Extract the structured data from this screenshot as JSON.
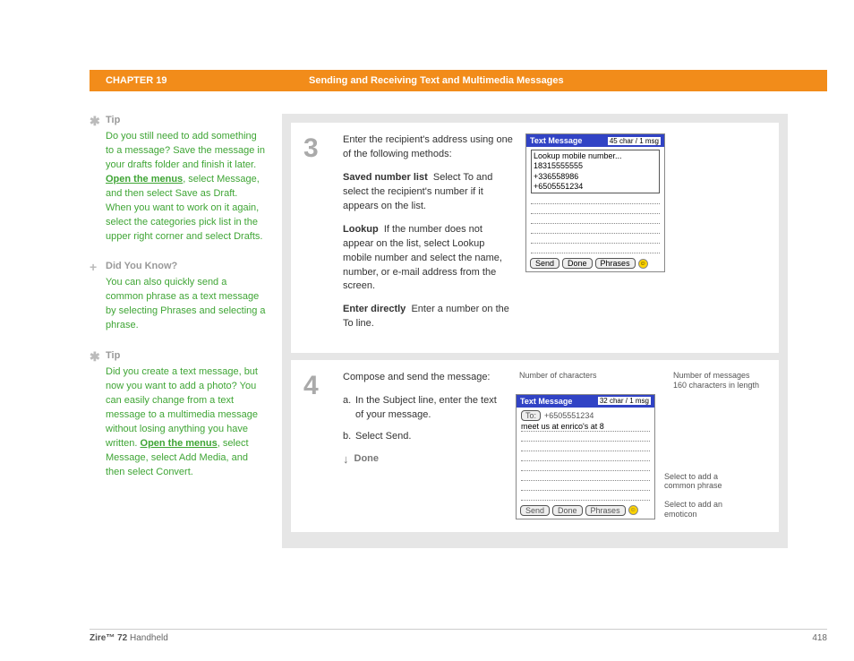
{
  "header": {
    "chapter": "CHAPTER 19",
    "title": "Sending and Receiving Text and Multimedia Messages"
  },
  "sidebar": {
    "tip1": {
      "label": "Tip",
      "body_1": "Do you still need to add something to a message? Save the message in your drafts folder and finish it later. ",
      "link": "Open the menus",
      "body_2": ", select Message, and then select Save as Draft. When you want to work on it again, select the categories pick list in the upper right corner and select Drafts."
    },
    "dyk": {
      "label": "Did You Know?",
      "body": "You can also quickly send a common phrase as a text message by selecting Phrases and selecting a phrase."
    },
    "tip2": {
      "label": "Tip",
      "body_1": "Did you create a text message, but now you want to add a photo? You can easily change from a text message to a multimedia message without losing anything you have written. ",
      "link": "Open the menus",
      "body_2": ", select Message, select Add Media, and then select Convert."
    }
  },
  "steps": {
    "s3": {
      "num": "3",
      "intro": "Enter the recipient's address using one of the following methods:",
      "saved_label": "Saved number list",
      "saved_text": "Select To and select the recipient's number if it appears on the list.",
      "lookup_label": "Lookup",
      "lookup_text": "If the number does not appear on the list, select Lookup mobile number and select the name, number, or e-mail address from the screen.",
      "enter_label": "Enter directly",
      "enter_text": "Enter a number on the To line.",
      "device": {
        "title": "Text Message",
        "counter": "45 char / 1 msg",
        "lookup_header": "Lookup mobile number...",
        "numbers": [
          "18315555555",
          "+336558986",
          "+6505551234"
        ],
        "btn_send": "Send",
        "btn_done": "Done",
        "btn_phrases": "Phrases"
      }
    },
    "s4": {
      "num": "4",
      "intro": "Compose and send the message:",
      "li_a": "In the Subject line, enter the text of your message.",
      "li_b": "Select Send.",
      "done": "Done",
      "labels": {
        "top_left": "Number of characters",
        "top_right": "Number of messages 160 characters in length",
        "side_phrase": "Select to add a common phrase",
        "side_emo": "Select to add an emoticon"
      },
      "device": {
        "title": "Text Message",
        "counter": "32 char / 1 msg",
        "to_label": "To:",
        "to_value": "+6505551234",
        "msg_text": "meet us at enrico's at 8",
        "btn_send": "Send",
        "btn_done": "Done",
        "btn_phrases": "Phrases"
      }
    }
  },
  "footer": {
    "product_bold": "Zire™ 72",
    "product_rest": " Handheld",
    "page": "418"
  }
}
